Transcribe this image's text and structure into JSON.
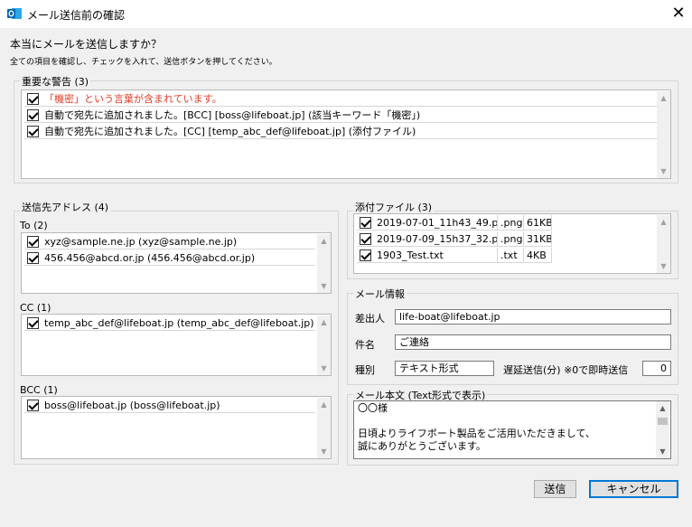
{
  "window": {
    "title": "メール送信前の確認",
    "icon": "outlook-icon",
    "close_glyph": "✕"
  },
  "heading": "本当にメールを送信しますか？",
  "subheading": "全ての項目を確認し、チェックを入れて、送信ボタンを押してください。",
  "warnings": {
    "label": "重要な警告 (3)",
    "items": [
      {
        "text": "「機密」という言葉が含まれています。",
        "checked": true
      },
      {
        "text": "自動で宛先に追加されました。[BCC] [boss@lifeboat.jp] (該当キーワード「機密」)",
        "checked": true
      },
      {
        "text": "自動で宛先に追加されました。[CC] [temp_abc_def@lifeboat.jp] (添付ファイル)",
        "checked": true
      }
    ]
  },
  "recipients": {
    "label": "送信先アドレス (4)",
    "to": {
      "label": "To (2)",
      "items": [
        "xyz@sample.ne.jp (xyz@sample.ne.jp)",
        "456.456@abcd.or.jp (456.456@abcd.or.jp)"
      ]
    },
    "cc": {
      "label": "CC (1)",
      "items": [
        "temp_abc_def@lifeboat.jp (temp_abc_def@lifeboat.jp)"
      ]
    },
    "bcc": {
      "label": "BCC (1)",
      "items": [
        "boss@lifeboat.jp (boss@lifeboat.jp)"
      ]
    }
  },
  "attachments": {
    "label": "添付ファイル (3)",
    "files": [
      {
        "name": "2019-07-01_11h43_49.png",
        "ext": ".png",
        "size": "61KB"
      },
      {
        "name": "2019-07-09_15h37_32.png",
        "ext": ".png",
        "size": "31KB"
      },
      {
        "name": "1903_Test.txt",
        "ext": ".txt",
        "size": "4KB"
      }
    ]
  },
  "mail_info": {
    "label": "メール情報",
    "sender_label": "差出人",
    "sender_value": "life-boat@lifeboat.jp",
    "subject_label": "件名",
    "subject_value": "ご連絡",
    "type_label": "種別",
    "type_value": "テキスト形式",
    "delay_label": "遅延送信(分) ※0で即時送信",
    "delay_value": "0"
  },
  "mail_body": {
    "label": "メール本文 (Text形式で表示)",
    "lines": [
      "〇〇様",
      "",
      "日頃よりライフボート製品をご活用いただきまして、",
      "誠にありがとうございます。"
    ]
  },
  "buttons": {
    "send": "送信",
    "cancel": "キャンセル"
  }
}
